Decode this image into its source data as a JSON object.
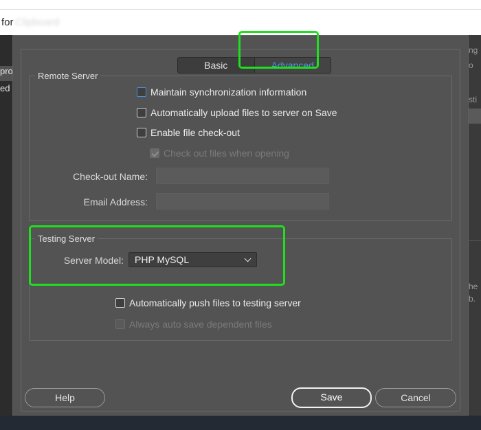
{
  "background": {
    "title_prefix": "for",
    "title_blurred": "Clipboard",
    "left_items": [
      "pro",
      "ed"
    ],
    "right_items": [
      "ng",
      "o",
      "sti",
      "he",
      "b."
    ]
  },
  "tabs": [
    {
      "label": "Basic",
      "active": false
    },
    {
      "label": "Advanced",
      "active": true
    }
  ],
  "remote_server": {
    "legend": "Remote Server",
    "options": [
      {
        "label": "Maintain synchronization information",
        "checked": false,
        "enabled": true
      },
      {
        "label": "Automatically upload files to server on Save",
        "checked": false,
        "enabled": true
      },
      {
        "label": "Enable file check-out",
        "checked": false,
        "enabled": true
      },
      {
        "label": "Check out files when opening",
        "checked": true,
        "enabled": false
      }
    ],
    "checkout_name_label": "Check-out Name:",
    "checkout_name_value": "",
    "email_label": "Email Address:",
    "email_value": ""
  },
  "testing_server": {
    "legend": "Testing Server",
    "server_model_label": "Server Model:",
    "server_model_value": "PHP MySQL",
    "options": [
      {
        "label": "Automatically push files to testing server",
        "checked": false,
        "enabled": true
      },
      {
        "label": "Always auto save dependent files",
        "checked": false,
        "enabled": false
      }
    ]
  },
  "buttons": {
    "help": "Help",
    "save": "Save",
    "cancel": "Cancel"
  },
  "colors": {
    "dialog_bg": "#535353",
    "active_tab_text": "#4b9ae6",
    "highlight": "#1ee01e"
  }
}
